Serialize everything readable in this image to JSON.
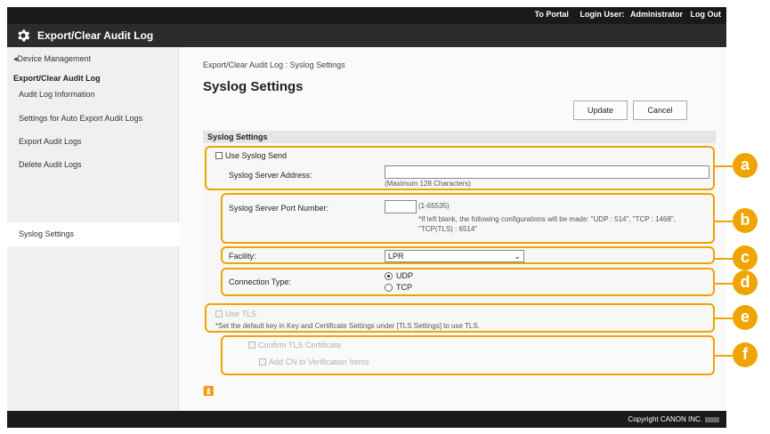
{
  "header": {
    "links": [
      "To Portal",
      "Login User:",
      "Administrator",
      "Log Out"
    ],
    "title": "Export/Clear Audit Log",
    "title_icon": "gear-icon"
  },
  "sidebar": {
    "back": "Device Management",
    "section": "Export/Clear Audit Log",
    "items": [
      {
        "label": "Audit Log Information"
      },
      {
        "label": "Settings for Auto Export Audit Logs"
      },
      {
        "label": "Export Audit Logs"
      },
      {
        "label": "Delete Audit Logs"
      },
      {
        "label": "Syslog Settings"
      }
    ]
  },
  "main": {
    "breadcrumb": "Export/Clear Audit Log : Syslog Settings",
    "title": "Syslog Settings",
    "update_label": "Update",
    "cancel_label": "Cancel",
    "section_title": "Syslog Settings",
    "use_syslog_send": "Use Syslog Send",
    "server_address_label": "Syslog Server Address:",
    "server_address_value": "",
    "server_address_hint": "(Maximum 128 Characters)",
    "port_label": "Syslog Server Port Number:",
    "port_value": "",
    "port_range": "(1-65535)",
    "port_note_1": "*If left blank, the following configurations will be made: \"UDP : 514\", \"TCP : 1468\",",
    "port_note_2": "\"TCP(TLS) : 6514\"",
    "facility_label": "Facility:",
    "facility_value": "LPR",
    "connection_type_label": "Connection Type:",
    "udp_label": "UDP",
    "tcp_label": "TCP",
    "use_tls": "Use TLS",
    "tls_note": "*Set the default key in Key and Certificate Settings under [TLS Settings] to use TLS.",
    "confirm_tls": "Confirm TLS Certificate",
    "add_cn": "Add CN to Verification Items",
    "to_top": "⏫"
  },
  "callouts": [
    "a",
    "b",
    "c",
    "d",
    "e",
    "f"
  ],
  "footer": {
    "copyright": "Copyright CANON INC."
  },
  "colors": {
    "accent": "#f0a400",
    "header_bg": "#1a1a1a",
    "title_bg": "#2b2b2b"
  }
}
